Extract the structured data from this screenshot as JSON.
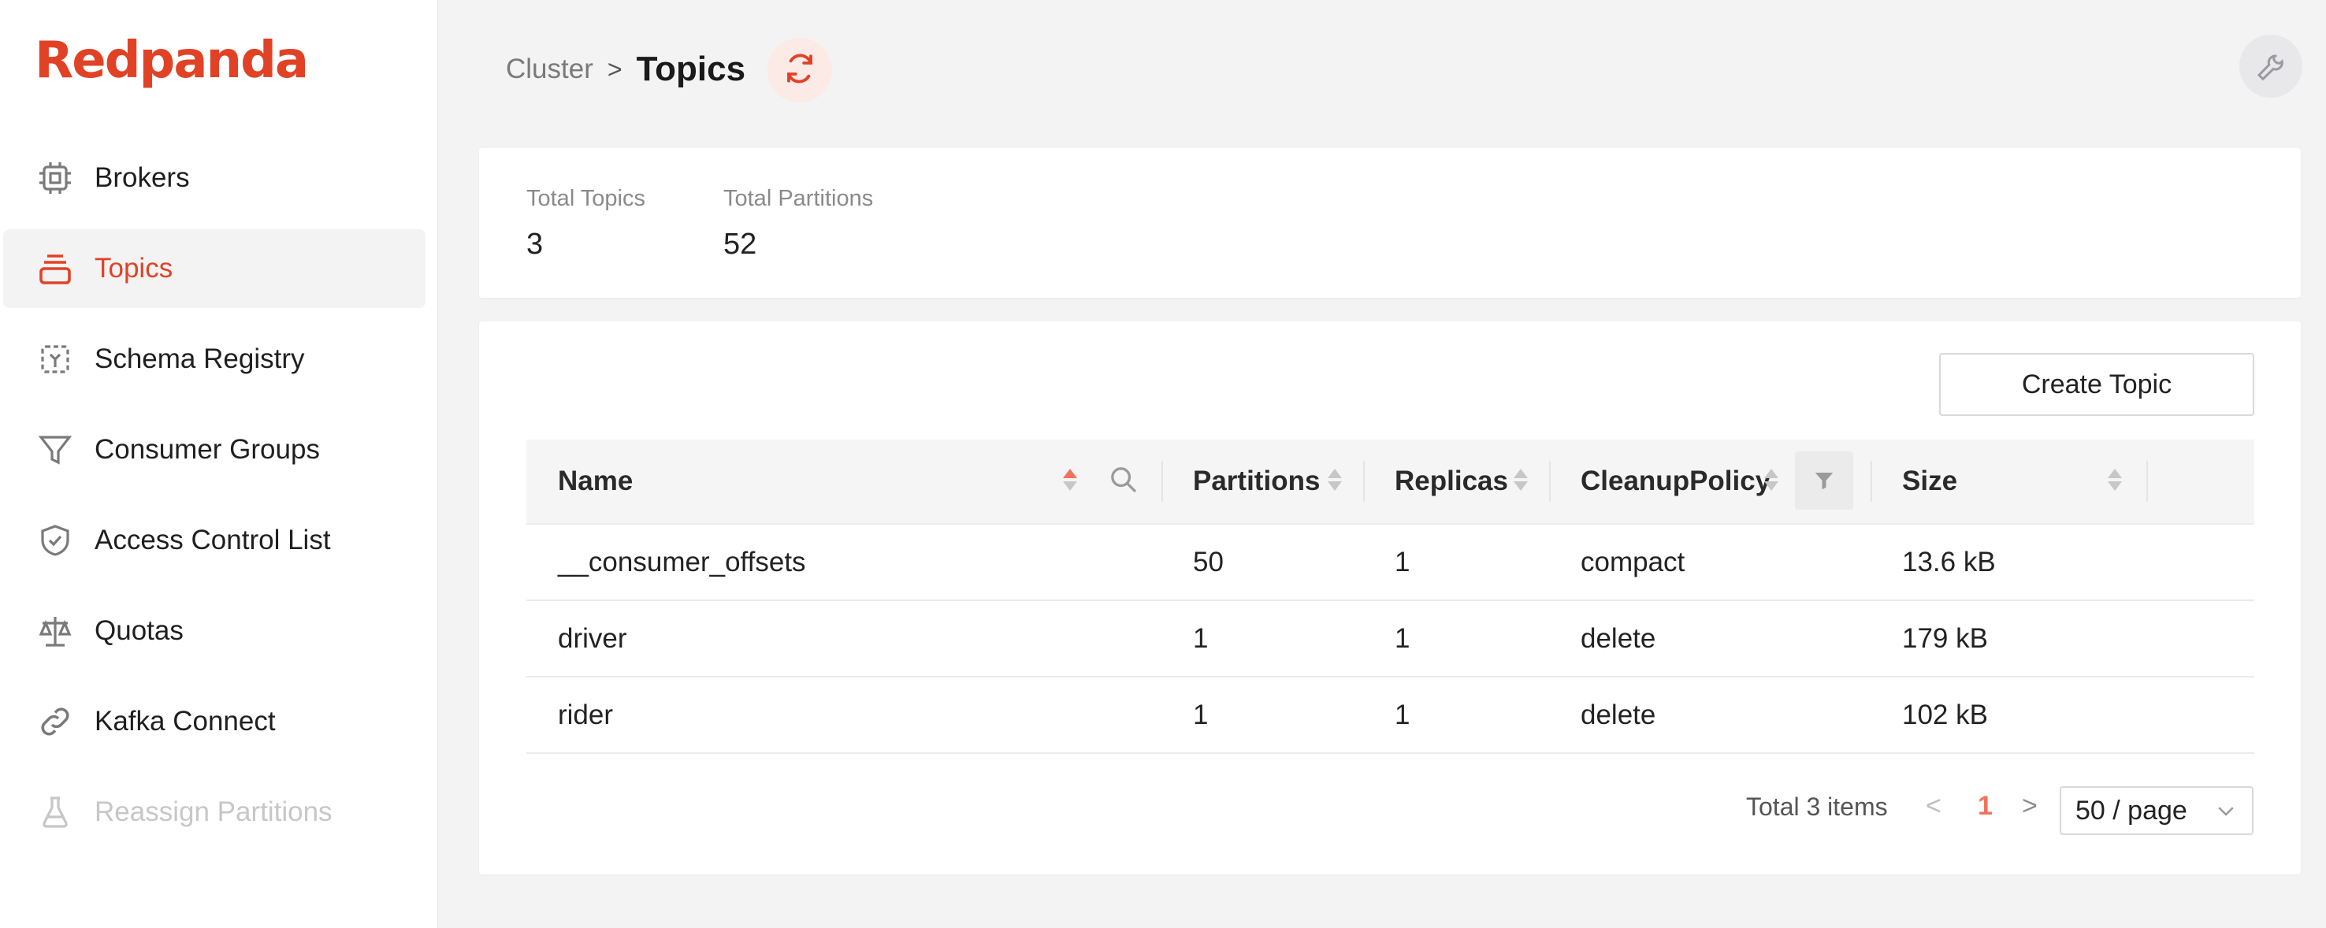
{
  "app": {
    "brand": "Redpanda"
  },
  "sidebar": {
    "items": [
      {
        "label": "Brokers",
        "icon": "cpu-chip-icon",
        "active": false,
        "disabled": false
      },
      {
        "label": "Topics",
        "icon": "stack-icon",
        "active": true,
        "disabled": false
      },
      {
        "label": "Schema Registry",
        "icon": "schema-icon",
        "active": false,
        "disabled": false
      },
      {
        "label": "Consumer Groups",
        "icon": "funnel-icon",
        "active": false,
        "disabled": false
      },
      {
        "label": "Access Control List",
        "icon": "shield-check-icon",
        "active": false,
        "disabled": false
      },
      {
        "label": "Quotas",
        "icon": "scale-icon",
        "active": false,
        "disabled": false
      },
      {
        "label": "Kafka Connect",
        "icon": "link-icon",
        "active": false,
        "disabled": false
      },
      {
        "label": "Reassign Partitions",
        "icon": "flask-icon",
        "active": false,
        "disabled": true
      }
    ]
  },
  "header": {
    "breadcrumb_parent": "Cluster",
    "separator": ">",
    "title": "Topics"
  },
  "stats": {
    "total_topics_label": "Total Topics",
    "total_topics_value": "3",
    "total_partitions_label": "Total Partitions",
    "total_partitions_value": "52"
  },
  "toolbar": {
    "create_label": "Create Topic"
  },
  "table": {
    "columns": [
      "Name",
      "Partitions",
      "Replicas",
      "CleanupPolicy",
      "Size"
    ],
    "rows": [
      {
        "name": "__consumer_offsets",
        "partitions": "50",
        "replicas": "1",
        "cleanup": "compact",
        "size": "13.6 kB"
      },
      {
        "name": "driver",
        "partitions": "1",
        "replicas": "1",
        "cleanup": "delete",
        "size": "179 kB"
      },
      {
        "name": "rider",
        "partitions": "1",
        "replicas": "1",
        "cleanup": "delete",
        "size": "102 kB"
      }
    ]
  },
  "pagination": {
    "total": "Total 3 items",
    "current_page": "1",
    "page_size": "50 / page",
    "prev": "<",
    "next": ">"
  },
  "colors": {
    "accent": "#e14226",
    "accent_soft": "#f0735c",
    "bg": "#f3f3f3"
  }
}
